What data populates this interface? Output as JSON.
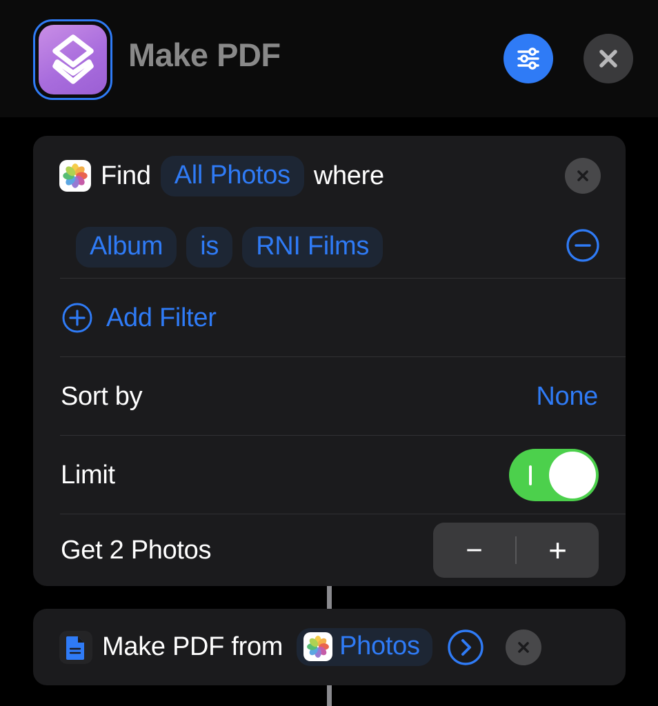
{
  "header": {
    "title": "Make PDF",
    "app_icon_name": "shortcut-layers-icon",
    "settings_button_label": "Settings",
    "close_button_label": "Close",
    "accent_blue": "#2f7bf6",
    "title_color": "#898989",
    "icon_gradient_from": "#c98ee6",
    "icon_gradient_to": "#9b5fd4"
  },
  "find_action": {
    "app_icon_name": "photos-app-icon",
    "find_label": "Find",
    "source_token": "All Photos",
    "where_label": "where",
    "remove_label": "Remove action",
    "filter": {
      "attribute": "Album",
      "operator": "is",
      "value": "RNI Films",
      "remove_label": "Remove filter"
    },
    "add_filter_label": "Add Filter",
    "sort_by_label": "Sort by",
    "sort_by_value": "None",
    "limit_label": "Limit",
    "limit_enabled": true,
    "get_label": "Get 2 Photos",
    "stepper_decrement": "−",
    "stepper_increment": "+",
    "toggle_on_color": "#4cd04c"
  },
  "pdf_action": {
    "icon_name": "document-icon",
    "label": "Make PDF from",
    "input_token": "Photos",
    "expand_label": "Show more",
    "remove_label": "Remove action"
  },
  "colors": {
    "page_background": "#000000",
    "card_background": "#1b1b1d",
    "pill_background": "#1d2634",
    "divider": "#313134",
    "connector": "#8a8a8e"
  }
}
